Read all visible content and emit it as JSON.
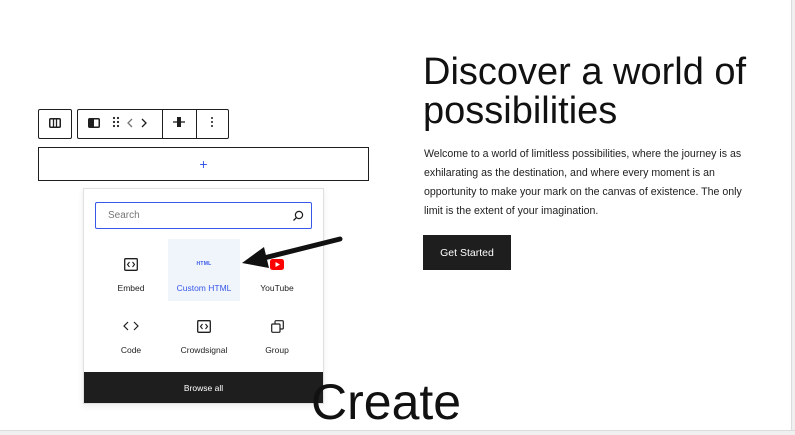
{
  "toolbar": {
    "parent_block_icon": "columns-icon",
    "block_type_icon": "column-icon",
    "drag_icon": "drag-handle-icon",
    "move_icon": "move-arrows-icon",
    "align_icon": "vertical-align-icon",
    "options_icon": "more-vertical-icon"
  },
  "appender": {
    "label": "+"
  },
  "inserter": {
    "search_placeholder": "Search",
    "blocks": [
      {
        "label": "Embed",
        "icon": "embed-icon"
      },
      {
        "label": "Custom HTML",
        "icon": "html-icon",
        "icon_text": "HTML",
        "active": true
      },
      {
        "label": "YouTube",
        "icon": "youtube-icon"
      },
      {
        "label": "Code",
        "icon": "code-icon"
      },
      {
        "label": "Crowdsignal",
        "icon": "crowdsignal-icon"
      },
      {
        "label": "Group",
        "icon": "group-icon"
      }
    ],
    "browse_all_label": "Browse all"
  },
  "hero": {
    "title": "Discover a world of possibilities",
    "body": "Welcome to a world of limitless possibilities, where the journey is as exhilarating as the destination, and where every moment is an opportunity to make your mark on the canvas of existence. The only limit is the extent of your imagination.",
    "cta_label": "Get Started"
  },
  "big_heading": "Create",
  "colors": {
    "accent": "#3858e9",
    "dark": "#1e1e1e",
    "youtube": "#ff0000"
  }
}
